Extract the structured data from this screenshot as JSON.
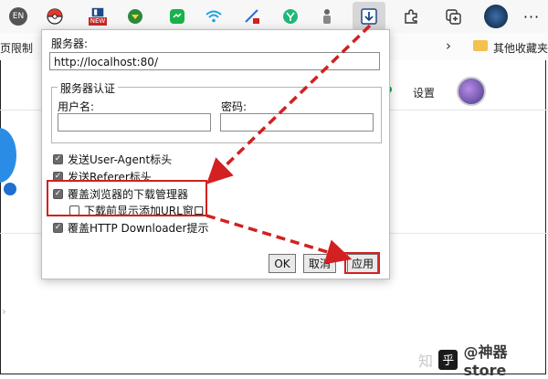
{
  "toolbar": {
    "en_badge": "EN",
    "new_badge": "NEW",
    "colors": {
      "active_bg": "#d7d7d7",
      "toolbar_bg": "#f7f7f7"
    }
  },
  "bookmarks": {
    "left_text": "页限制",
    "right_text": "其他收藏夹"
  },
  "page": {
    "settings_label": "设置"
  },
  "dialog": {
    "server_label": "服务器:",
    "server_value": "http://localhost:80/",
    "auth_legend": "服务器认证",
    "username_label": "用户名:",
    "username_value": "",
    "password_label": "密码:",
    "password_value": "",
    "options": [
      {
        "label": "发送User-Agent标头",
        "checked": true
      },
      {
        "label": "发送Referer标头",
        "checked": true
      },
      {
        "label": "覆盖浏览器的下载管理器",
        "checked": true
      },
      {
        "label": "下载前显示添加URL窗口",
        "checked": false
      },
      {
        "label": "覆盖HTTP Downloader提示",
        "checked": true
      }
    ],
    "buttons": {
      "ok": "OK",
      "cancel": "取消",
      "apply": "应用"
    }
  },
  "annotation_colors": {
    "highlight": "#d32020"
  },
  "watermark": {
    "prefix": "知",
    "badge": "乎",
    "suffix": "@神器store"
  }
}
